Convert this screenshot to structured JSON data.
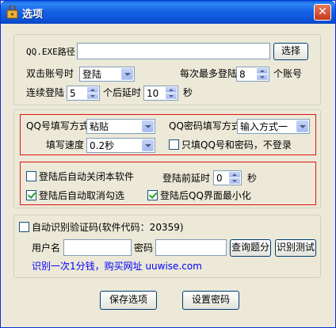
{
  "window": {
    "title": "选项"
  },
  "top_group": {
    "qq_exe_label": "QQ.EXE路径",
    "qq_exe_value": "",
    "browse_label": "选择",
    "double_click_label": "双击账号时",
    "double_click_value": "登陆",
    "max_login_prefix": "每次最多登陆",
    "max_login_value": "8",
    "max_login_suffix": "个账号",
    "continuous_label": "连续登陆",
    "continuous_value": "5",
    "delay_label": "个后延时",
    "delay_value": "10",
    "delay_unit": "秒"
  },
  "fill_group": {
    "qq_fill_label": "QQ号填写方式",
    "qq_fill_value": "粘贴",
    "pwd_fill_label": "QQ密码填写方式",
    "pwd_fill_value": "输入方式一",
    "speed_label": "填写速度",
    "speed_value": "0.2秒",
    "only_fill_label": "只填QQ号和密码，不登录",
    "only_fill_checked": false
  },
  "after_group": {
    "auto_close_label": "登陆后自动关闭本软件",
    "auto_close_checked": false,
    "pre_delay_label": "登陆前延时",
    "pre_delay_value": "0",
    "pre_delay_unit": "秒",
    "auto_cancel_label": "登陆后自动取消勾选",
    "auto_cancel_checked": true,
    "minimize_label": "登陆后QQ界面最小化",
    "minimize_checked": true
  },
  "captcha_group": {
    "auto_captcha_label": "自动识别验证码(软件代码：20359)",
    "auto_captcha_checked": false,
    "username_label": "用户名",
    "username_value": "",
    "password_label": "密码",
    "password_value": "",
    "check_balance_label": "查询题分",
    "test_label": "识别测试",
    "info_text": "识别一次1分钱，购买网址 uuwise.com"
  },
  "footer": {
    "save_label": "保存选项",
    "set_password_label": "设置密码"
  },
  "colors": {
    "title_bar": "#0A5FDB",
    "highlight_border": "#E01010",
    "link_text": "#0000FF"
  }
}
